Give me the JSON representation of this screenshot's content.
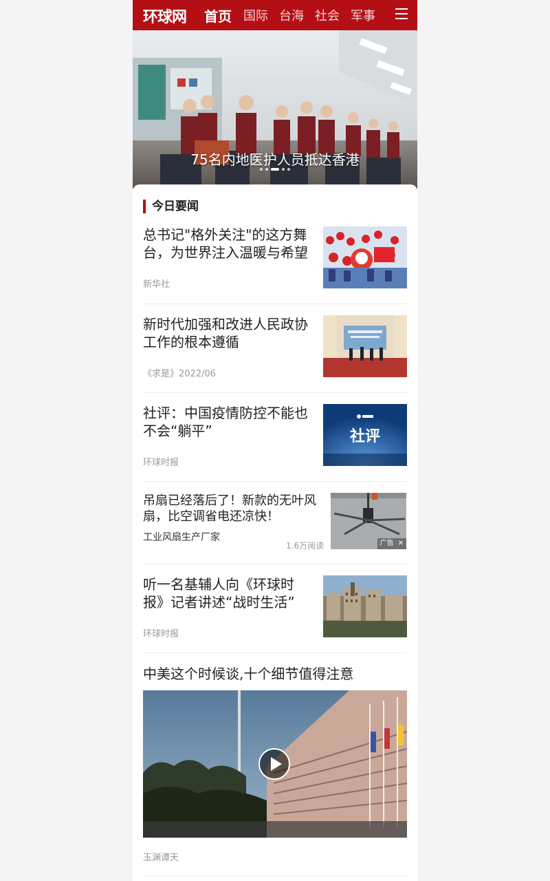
{
  "header": {
    "logo": "环球网",
    "nav": [
      "首页",
      "国际",
      "台海",
      "社会",
      "军事"
    ],
    "active_nav": 0,
    "brand_color": "#b50f16"
  },
  "hero": {
    "caption": "75名内地医护人员抵达香港",
    "slide_count": 5,
    "active_slide": 2
  },
  "section": {
    "title": "今日要闻"
  },
  "articles": [
    {
      "title": "总书记\"格外关注\"的这方舞台，为世界注入温暖与希望",
      "source": "新华社"
    },
    {
      "title": "新时代加强和改进人民政协工作的根本遵循",
      "source": "《求是》2022/06"
    },
    {
      "title": "社评：中国疫情防控不能也不会“躺平”",
      "source": "环球时报",
      "thumb_text": "社评"
    },
    {
      "title": "听一名基辅人向《环球时报》记者讲述“战时生活”",
      "source": "环球时报"
    }
  ],
  "ad": {
    "title": "吊扇已经落后了！新款的无叶风扇，比空调省电还凉快！",
    "source": "工业风扇生产厂家",
    "reads": "1.6万阅读",
    "badge": "广告"
  },
  "video": {
    "title": "中美这个时候谈,十个细节值得注意",
    "source": "玉渊谭天"
  },
  "icons": {
    "menu": "hamburger-menu-icon",
    "play": "play-icon",
    "close": "close-icon"
  }
}
